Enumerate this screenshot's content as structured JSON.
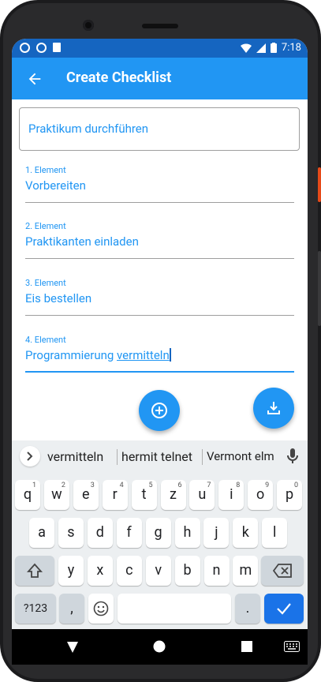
{
  "status": {
    "time": "7:18"
  },
  "appbar": {
    "title": "Create Checklist"
  },
  "checklist": {
    "title_value": "Praktikum durchführen",
    "items": [
      {
        "label": "1. Element",
        "value": "Vorbereiten"
      },
      {
        "label": "2. Element",
        "value": "Praktikanten einladen"
      },
      {
        "label": "3. Element",
        "value": "Eis bestellen"
      },
      {
        "label": "4. Element",
        "value_prefix": "Programmierung ",
        "value_word": "vermitteln"
      }
    ]
  },
  "keyboard": {
    "suggestions": [
      "vermitteln",
      "hermit telnet",
      "Vermont elm"
    ],
    "row1": [
      {
        "k": "q",
        "h": "1"
      },
      {
        "k": "w",
        "h": "2"
      },
      {
        "k": "e",
        "h": "3"
      },
      {
        "k": "r",
        "h": "4"
      },
      {
        "k": "t",
        "h": "5"
      },
      {
        "k": "z",
        "h": "6"
      },
      {
        "k": "u",
        "h": "7"
      },
      {
        "k": "i",
        "h": "8"
      },
      {
        "k": "o",
        "h": "9"
      },
      {
        "k": "p",
        "h": "0"
      }
    ],
    "row2": [
      "a",
      "s",
      "d",
      "f",
      "g",
      "h",
      "j",
      "k",
      "l"
    ],
    "row3": [
      "y",
      "x",
      "c",
      "v",
      "b",
      "n",
      "m"
    ],
    "symbols_label": "?123",
    "comma": ",",
    "period": "."
  }
}
